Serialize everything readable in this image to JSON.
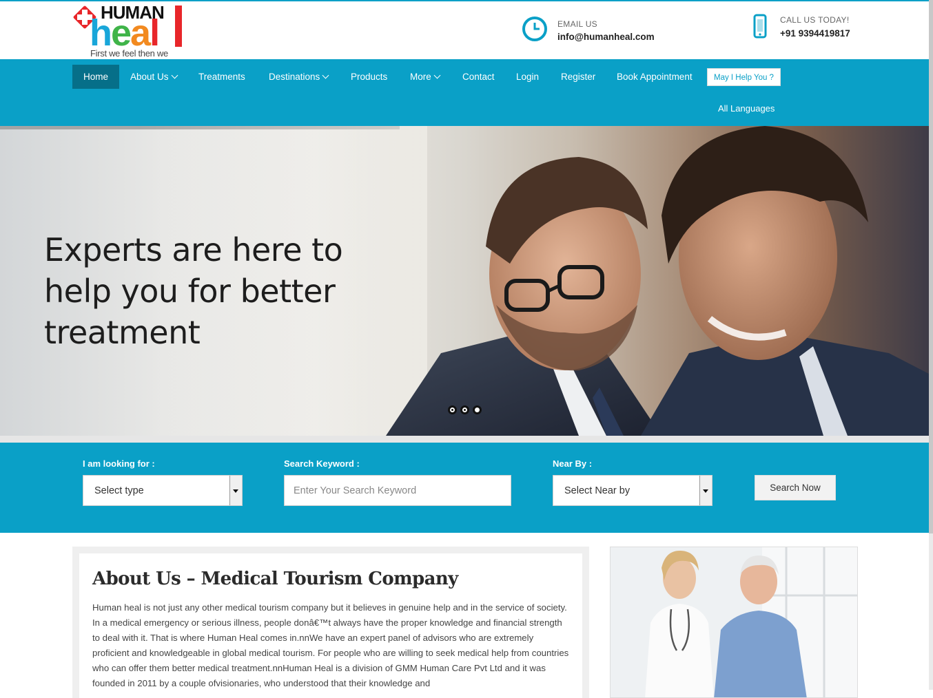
{
  "brand": {
    "word_top": "HUMAN",
    "word_main": [
      "h",
      "e",
      "a",
      "l"
    ],
    "tagline": "First we feel then we heal."
  },
  "contact": {
    "email_label": "EMAIL US",
    "email_value": "info@humanheal.com",
    "phone_label": "CALL US TODAY!",
    "phone_value": "+91 9394419817"
  },
  "nav": {
    "items": [
      {
        "label": "Home"
      },
      {
        "label": "About Us"
      },
      {
        "label": "Treatments"
      },
      {
        "label": "Destinations"
      },
      {
        "label": "Products"
      },
      {
        "label": "More"
      },
      {
        "label": "Contact"
      },
      {
        "label": "Login"
      },
      {
        "label": "Register"
      },
      {
        "label": "Book Appointment"
      }
    ],
    "help_button": "May I Help You ?",
    "languages": "All Languages"
  },
  "hero": {
    "line1": "Experts are here to",
    "line2": "help you for better",
    "line3": "treatment",
    "slides_total": 3,
    "active_slide": 3
  },
  "search": {
    "type_label": "I am looking for :",
    "type_value": "Select type",
    "keyword_label": "Search Keyword :",
    "keyword_placeholder": "Enter Your Search Keyword",
    "near_label": "Near By :",
    "near_value": "Select Near by",
    "button": "Search Now"
  },
  "about": {
    "title": "About Us – Medical Tourism Company",
    "body": "Human heal is not just any other medical tourism company but it believes in genuine help and in the service of society. In a medical emergency or serious illness, people donâ€™t always have the proper knowledge and financial strength to deal with it. That is where Human Heal comes in.nnWe have an expert panel of advisors who are extremely proficient and knowledgeable in global medical tourism. For people who are willing to seek medical help from countries who can offer them better medical treatment.nnHuman Heal is a division of GMM Human Care Pvt Ltd and it was founded in 2011 by a couple ofvisionaries, who understood that their knowledge and"
  },
  "colors": {
    "primary": "#0aa0c7",
    "active_nav": "#066f89",
    "logo_red": "#e8262a",
    "logo_blue": "#19a6d9",
    "logo_green": "#3fb449",
    "logo_orange": "#f28a20"
  }
}
